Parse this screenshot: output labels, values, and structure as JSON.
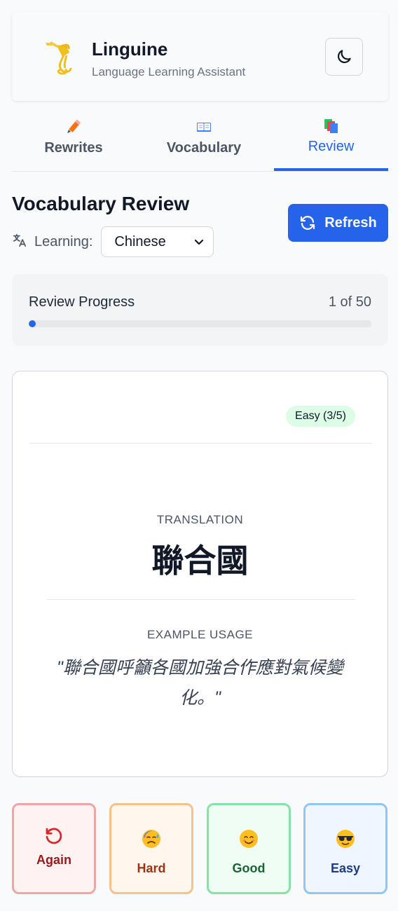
{
  "app": {
    "title": "Linguine",
    "subtitle": "Language Learning Assistant"
  },
  "tabs": [
    {
      "label": "Rewrites",
      "icon": "pencil-icon"
    },
    {
      "label": "Vocabulary",
      "icon": "book-icon"
    },
    {
      "label": "Review",
      "icon": "cards-icon",
      "active": true
    }
  ],
  "review": {
    "title": "Vocabulary Review",
    "learning_label": "Learning:",
    "language": "Chinese",
    "refresh_label": "Refresh"
  },
  "progress": {
    "label": "Review Progress",
    "count": "1 of 50",
    "fraction": 0.02
  },
  "card": {
    "difficulty": "Easy (3/5)",
    "translation_label": "TRANSLATION",
    "translation": "聯合國",
    "example_label": "EXAMPLE USAGE",
    "example": "\"聯合國呼籲各國加強合作應對氣候變化。\""
  },
  "ratings": [
    {
      "label": "Again",
      "icon": "undo-icon"
    },
    {
      "label": "Hard",
      "icon": "sweat-face-icon"
    },
    {
      "label": "Good",
      "icon": "smile-face-icon"
    },
    {
      "label": "Easy",
      "icon": "sunglasses-face-icon"
    }
  ],
  "colors": {
    "accent": "#2563eb",
    "badge_easy": "#dcfce7"
  }
}
